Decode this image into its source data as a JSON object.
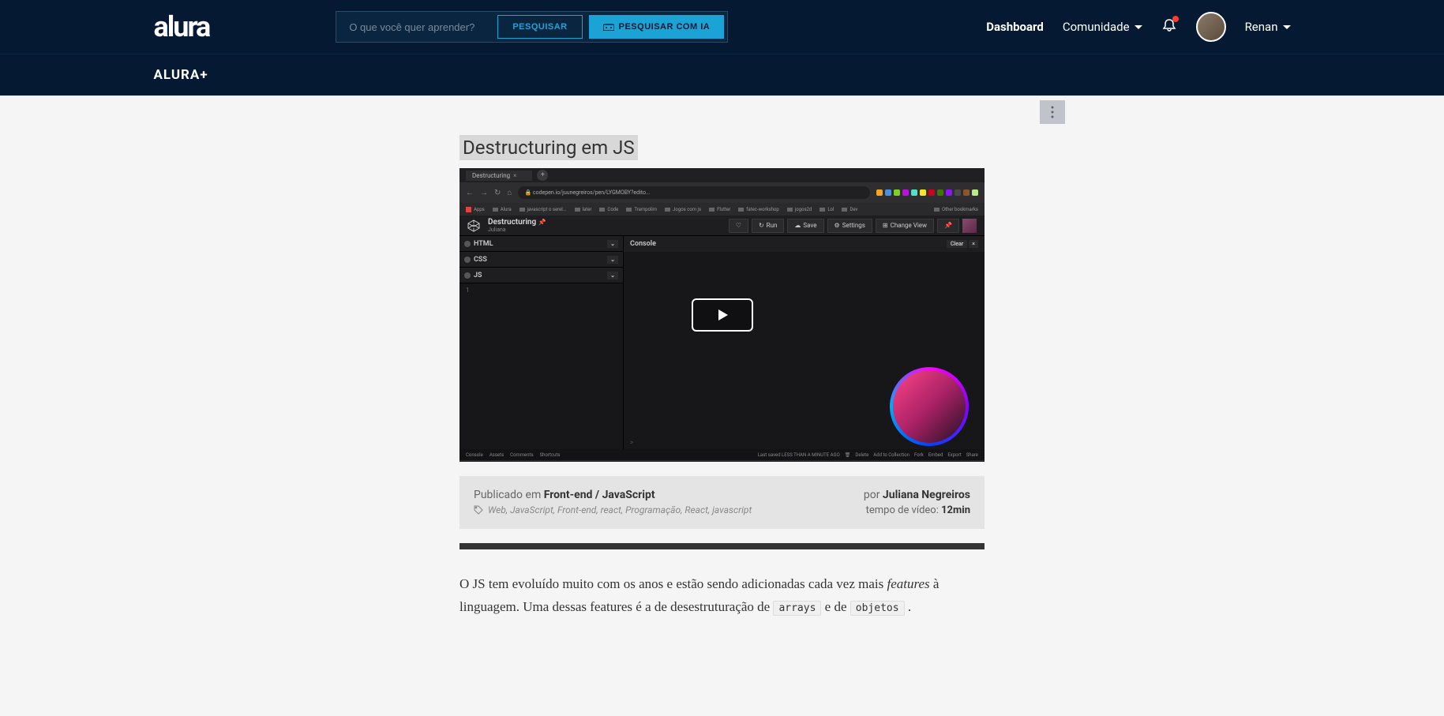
{
  "header": {
    "logo": "alura",
    "search_placeholder": "O que você quer aprender?",
    "search_button": "PESQUISAR",
    "search_ai_button": "PESQUISAR COM IA",
    "dashboard": "Dashboard",
    "comunidade": "Comunidade",
    "user_name": "Renan"
  },
  "subheader": {
    "title": "ALURA+"
  },
  "page": {
    "title": "Destructuring em JS"
  },
  "video": {
    "tab_title": "Destructuring",
    "url": "codepen.io/juunegreiros/pen/LYGMOBY?edito...",
    "bookmarks": [
      "Apps",
      "Alura",
      "javascript o serel...",
      "later",
      "Code",
      "Trampolim",
      "Jogos com js",
      "Flutter",
      "fatec-workshop",
      "jogos2d",
      "Lol",
      "Dev",
      "Other bookmarks"
    ],
    "codepen_title": "Destructuring",
    "codepen_author": "Juliana",
    "actions": {
      "heart": "♡",
      "run": "Run",
      "save": "Save",
      "settings": "Settings",
      "change_view": "Change View"
    },
    "panels": {
      "html": "HTML",
      "css": "CSS",
      "js": "JS",
      "console": "Console",
      "clear": "Clear"
    },
    "line_num": "1",
    "prompt": ">",
    "footer": {
      "console": "Console",
      "assets": "Assets",
      "comments": "Comments",
      "shortcuts": "Shortcuts",
      "saved": "Last saved LESS THAN A MINUTE AGO",
      "delete": "Delete",
      "collection": "Add to Collection",
      "fork": "Fork",
      "embed": "Embed",
      "export": "Export",
      "share": "Share"
    }
  },
  "meta": {
    "published_label": "Publicado em ",
    "published_in": "Front-end / JavaScript",
    "tags": "Web, JavaScript, Front-end, react, Programação, React, javascript",
    "by_label": "por ",
    "author": "Juliana Negreiros",
    "time_label": "tempo de vídeo: ",
    "time": "12min"
  },
  "article": {
    "p1a": "O JS tem evoluído muito com os anos e estão sendo adicionadas cada vez mais ",
    "p1_em": "features",
    "p1b": " à linguagem. Uma dessas features é a de desestruturação de ",
    "code1": "arrays",
    "p1c": " e de ",
    "code2": "objetos",
    "p1d": " ."
  }
}
